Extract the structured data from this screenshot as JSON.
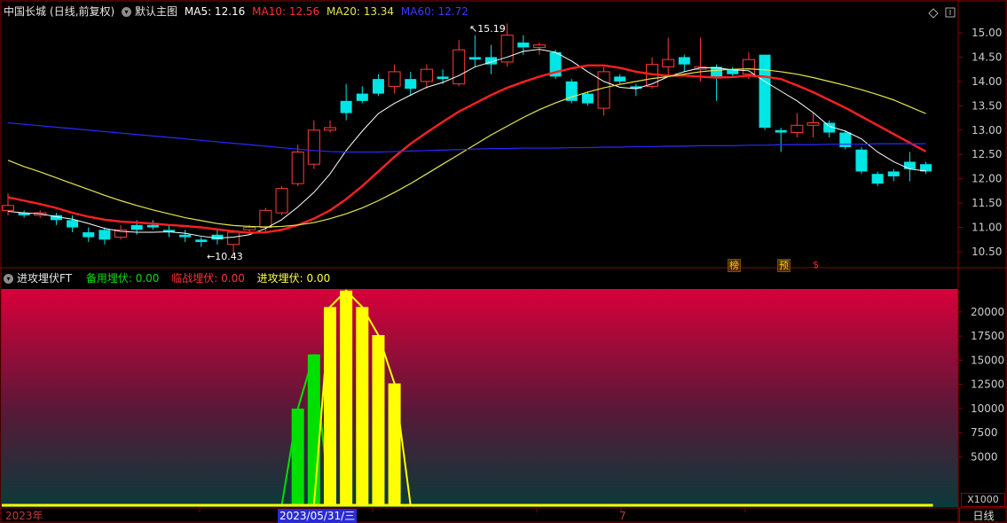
{
  "header": {
    "stock_name": "中国长城",
    "period_info": "(日线,前复权)",
    "main_chart_label": "默认主图",
    "ma5": "MA5: 12.16",
    "ma10": "MA10: 12.56",
    "ma20": "MA20: 13.34",
    "ma60": "MA60: 12.72"
  },
  "indicator_header": {
    "name": "进攻埋伏FT",
    "backup": "备用埋伏: 0.00",
    "near": "临战埋伏: 0.00",
    "attack": "进攻埋伏: 0.00"
  },
  "annotations": {
    "high_label": "15.19",
    "low_label": "10.43",
    "badge_1": "榜",
    "badge_2": "预",
    "badge_3": "$"
  },
  "footer": {
    "year_label": "2023年",
    "cursor_date": "2023/05/31/三",
    "month_label": "7",
    "period_button": "日线"
  },
  "colors": {
    "up": "#ff3b3b",
    "down": "#00e5e5",
    "ma5": "#ffffff",
    "ma10": "#ff2020",
    "ma20": "#e6e64c",
    "ma60": "#2a2aff",
    "bar_green": "#00e000",
    "bar_yellow": "#ffff00",
    "indicator_bg_top": "#d8003a",
    "indicator_bg_bottom": "#0c3a3a"
  },
  "chart_data": [
    {
      "type": "candlestick",
      "ylim": [
        10.2,
        15.3
      ],
      "yticks": [
        10.5,
        11.0,
        11.5,
        12.0,
        12.5,
        13.0,
        13.5,
        14.0,
        14.5,
        15.0
      ],
      "candles": [
        [
          11.35,
          11.45,
          11.25,
          11.7
        ],
        [
          11.3,
          11.25,
          11.2,
          11.35
        ],
        [
          11.25,
          11.3,
          11.2,
          11.35
        ],
        [
          11.25,
          11.15,
          11.05,
          11.3
        ],
        [
          11.15,
          11.0,
          10.9,
          11.25
        ],
        [
          10.9,
          10.8,
          10.7,
          11.0
        ],
        [
          10.95,
          10.75,
          10.65,
          11.0
        ],
        [
          10.8,
          10.95,
          10.75,
          11.05
        ],
        [
          11.05,
          10.95,
          10.85,
          11.15
        ],
        [
          11.05,
          11.0,
          10.95,
          11.15
        ],
        [
          10.95,
          10.9,
          10.8,
          11.05
        ],
        [
          10.85,
          10.8,
          10.7,
          10.95
        ],
        [
          10.75,
          10.7,
          10.6,
          10.8
        ],
        [
          10.85,
          10.75,
          10.65,
          10.95
        ],
        [
          10.65,
          10.9,
          10.43,
          10.95
        ],
        [
          10.95,
          11.0,
          10.85,
          11.05
        ],
        [
          11.0,
          11.35,
          10.9,
          11.4
        ],
        [
          11.3,
          11.8,
          11.25,
          11.85
        ],
        [
          11.9,
          12.55,
          11.85,
          12.7
        ],
        [
          12.3,
          13.0,
          12.2,
          13.2
        ],
        [
          13.0,
          13.05,
          12.95,
          13.2
        ],
        [
          13.6,
          13.35,
          13.2,
          13.95
        ],
        [
          13.75,
          13.6,
          13.55,
          13.9
        ],
        [
          14.05,
          13.75,
          13.7,
          14.15
        ],
        [
          13.9,
          14.2,
          13.75,
          14.35
        ],
        [
          14.05,
          13.85,
          13.7,
          14.2
        ],
        [
          14.0,
          14.25,
          13.85,
          14.35
        ],
        [
          14.1,
          14.05,
          13.95,
          14.25
        ],
        [
          13.95,
          14.65,
          13.9,
          14.85
        ],
        [
          14.5,
          14.45,
          14.3,
          14.95
        ],
        [
          14.5,
          14.35,
          14.15,
          14.75
        ],
        [
          14.4,
          14.95,
          14.3,
          15.19
        ],
        [
          14.8,
          14.7,
          14.55,
          14.95
        ],
        [
          14.7,
          14.75,
          14.55,
          14.8
        ],
        [
          14.6,
          14.1,
          14.05,
          14.65
        ],
        [
          14.0,
          13.6,
          13.55,
          14.05
        ],
        [
          13.75,
          13.55,
          13.5,
          13.8
        ],
        [
          13.45,
          14.2,
          13.3,
          14.3
        ],
        [
          14.1,
          14.0,
          13.95,
          14.15
        ],
        [
          13.9,
          13.85,
          13.7,
          13.95
        ],
        [
          13.9,
          14.35,
          13.85,
          14.5
        ],
        [
          14.3,
          14.45,
          14.1,
          14.9
        ],
        [
          14.5,
          14.35,
          14.2,
          14.55
        ],
        [
          14.25,
          14.3,
          14.0,
          14.9
        ],
        [
          14.3,
          14.1,
          13.6,
          14.35
        ],
        [
          14.25,
          14.15,
          14.1,
          14.3
        ],
        [
          14.15,
          14.45,
          14.05,
          14.6
        ],
        [
          14.55,
          13.05,
          13.0,
          14.55
        ],
        [
          13.0,
          12.95,
          12.55,
          13.05
        ],
        [
          12.95,
          13.1,
          12.85,
          13.35
        ],
        [
          13.1,
          13.15,
          12.85,
          13.35
        ],
        [
          13.15,
          12.95,
          12.85,
          13.2
        ],
        [
          12.95,
          12.65,
          12.6,
          13.0
        ],
        [
          12.6,
          12.15,
          12.1,
          12.65
        ],
        [
          12.1,
          11.9,
          11.85,
          12.15
        ],
        [
          12.15,
          12.05,
          11.95,
          12.2
        ],
        [
          12.35,
          12.2,
          11.95,
          12.55
        ],
        [
          12.3,
          12.15,
          12.1,
          12.35
        ]
      ],
      "ma_series": [
        {
          "name": "MA5",
          "values": [
            11.33,
            11.3,
            11.28,
            11.22,
            11.17,
            11.08,
            10.98,
            10.92,
            10.9,
            10.9,
            10.91,
            10.88,
            10.82,
            10.78,
            10.8,
            10.85,
            10.98,
            11.16,
            11.42,
            11.72,
            12.1,
            12.58,
            12.98,
            13.34,
            13.55,
            13.72,
            13.88,
            13.98,
            14.12,
            14.3,
            14.4,
            14.5,
            14.62,
            14.66,
            14.6,
            14.42,
            14.2,
            14.0,
            13.88,
            13.85,
            13.95,
            14.1,
            14.2,
            14.28,
            14.28,
            14.24,
            14.22,
            14.0,
            13.8,
            13.6,
            13.36,
            13.08,
            12.98,
            12.82,
            12.55,
            12.35,
            12.2,
            12.16
          ]
        },
        {
          "name": "MA10",
          "values": [
            11.62,
            11.55,
            11.48,
            11.4,
            11.3,
            11.22,
            11.16,
            11.12,
            11.1,
            11.08,
            11.05,
            11.03,
            11.0,
            10.96,
            10.92,
            10.89,
            10.9,
            10.95,
            11.05,
            11.18,
            11.35,
            11.58,
            11.85,
            12.15,
            12.45,
            12.72,
            12.95,
            13.17,
            13.38,
            13.55,
            13.72,
            13.87,
            13.99,
            14.1,
            14.19,
            14.27,
            14.33,
            14.33,
            14.28,
            14.2,
            14.15,
            14.12,
            14.12,
            14.1,
            14.08,
            14.09,
            14.12,
            14.1,
            14.05,
            13.92,
            13.78,
            13.62,
            13.46,
            13.28,
            13.1,
            12.92,
            12.74,
            12.56
          ]
        },
        {
          "name": "MA20",
          "values": [
            12.38,
            12.25,
            12.14,
            12.02,
            11.9,
            11.78,
            11.66,
            11.55,
            11.45,
            11.36,
            11.28,
            11.2,
            11.14,
            11.08,
            11.04,
            11.02,
            11.01,
            11.02,
            11.05,
            11.1,
            11.18,
            11.28,
            11.4,
            11.55,
            11.72,
            11.9,
            12.1,
            12.3,
            12.5,
            12.7,
            12.9,
            13.08,
            13.26,
            13.42,
            13.56,
            13.68,
            13.78,
            13.87,
            13.94,
            14.0,
            14.06,
            14.1,
            14.15,
            14.2,
            14.23,
            14.25,
            14.26,
            14.24,
            14.2,
            14.15,
            14.08,
            14.0,
            13.92,
            13.83,
            13.73,
            13.62,
            13.48,
            13.34
          ]
        },
        {
          "name": "MA60",
          "values": [
            13.15,
            13.12,
            13.09,
            13.06,
            13.03,
            13.0,
            12.97,
            12.94,
            12.91,
            12.88,
            12.85,
            12.82,
            12.79,
            12.76,
            12.73,
            12.7,
            12.67,
            12.64,
            12.61,
            12.58,
            12.56,
            12.55,
            12.55,
            12.55,
            12.56,
            12.57,
            12.58,
            12.59,
            12.6,
            12.61,
            12.62,
            12.62,
            12.63,
            12.63,
            12.63,
            12.64,
            12.64,
            12.65,
            12.65,
            12.66,
            12.66,
            12.67,
            12.67,
            12.68,
            12.68,
            12.68,
            12.69,
            12.69,
            12.7,
            12.7,
            12.7,
            12.71,
            12.71,
            12.71,
            12.72,
            12.72,
            12.72,
            12.72
          ]
        }
      ]
    },
    {
      "type": "bar",
      "ylabel_unit": "X1000",
      "ylim": [
        0,
        22000
      ],
      "yticks": [
        5000,
        7500,
        10000,
        12500,
        15000,
        17500,
        20000
      ],
      "series": [
        {
          "name": "备用埋伏",
          "values": [
            0,
            0,
            0,
            0,
            0,
            0,
            0,
            0,
            0,
            0,
            0,
            0,
            0,
            0,
            0,
            0,
            0,
            0,
            10000,
            15600,
            0,
            0,
            0,
            0,
            0,
            0,
            0,
            0,
            0,
            0,
            0,
            0,
            0,
            0,
            0,
            0,
            0,
            0,
            0,
            0,
            0,
            0,
            0,
            0,
            0,
            0,
            0,
            0,
            0,
            0,
            0,
            0,
            0,
            0,
            0,
            0,
            0,
            0
          ]
        },
        {
          "name": "进攻埋伏",
          "values": [
            0,
            0,
            0,
            0,
            0,
            0,
            0,
            0,
            0,
            0,
            0,
            0,
            0,
            0,
            0,
            0,
            0,
            0,
            0,
            0,
            20500,
            22200,
            20500,
            17600,
            12600,
            0,
            0,
            0,
            0,
            0,
            0,
            0,
            0,
            0,
            0,
            0,
            0,
            0,
            0,
            0,
            0,
            0,
            0,
            0,
            0,
            0,
            0,
            0,
            0,
            0,
            0,
            0,
            0,
            0,
            0,
            0,
            0,
            0
          ]
        }
      ]
    }
  ]
}
